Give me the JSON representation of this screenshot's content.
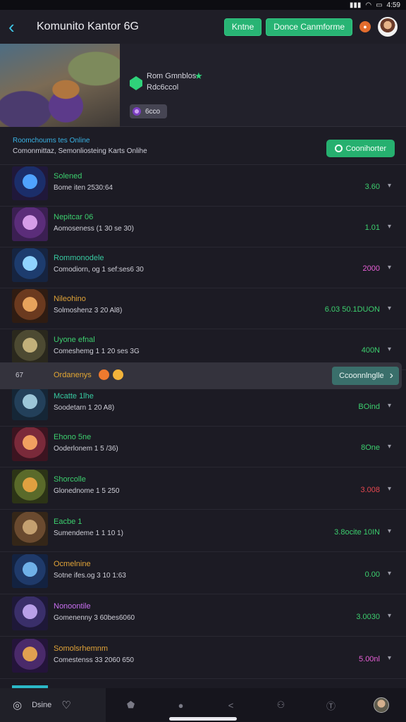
{
  "status": {
    "time": "4:59",
    "wifi": "wifi-icon",
    "signal": "signal-icon",
    "battery": "battery-icon"
  },
  "header": {
    "title": "Komunito Kantor 6G",
    "btn1": "Kntne",
    "btn2": "Donce Canmforme",
    "notif_icon": "notification-icon",
    "avatar": "profile-avatar"
  },
  "hero": {
    "name": "Rom Gmnblos",
    "sub": "Rdc6ccol",
    "chip": "6cco"
  },
  "section": {
    "title": "Roomchoums tes Online",
    "sub": "Comonmittaz, Semonliosteing Karts Onlihe",
    "button": "Coonihorter"
  },
  "banner": {
    "left": "67",
    "text": "Ordanenys",
    "button": "Ccoonnlnglle"
  },
  "players": [
    {
      "name": "Solened",
      "sub": "Bome iten 2530:64",
      "value": "3.60",
      "color": "#3ccf6e",
      "value_color": "#3ccf6e",
      "thumb": [
        "#1b2e6a",
        "#4fa3ff",
        "#20183a"
      ]
    },
    {
      "name": "Nepitcar 06",
      "sub": "Aomoseness (1 30 se 30)",
      "value": "1.01",
      "color": "#3ccf6e",
      "value_color": "#3ccf6e",
      "thumb": [
        "#5b2d7a",
        "#d59ce8",
        "#3b1f52"
      ]
    },
    {
      "name": "Rommonodele",
      "sub": "Comodiorn, og 1 sef:ses6 30",
      "value": "2000",
      "color": "#37c9a0",
      "value_color": "#e65fd6",
      "thumb": [
        "#1d3c6e",
        "#8fd3ff",
        "#162440"
      ]
    },
    {
      "name": "Nileohino",
      "sub": "Solmoshenz 3 20 Al8)",
      "value": "6.03 50.1DUON",
      "color": "#e0a338",
      "value_color": "#3ccf6e",
      "thumb": [
        "#6b3a1f",
        "#e6a35c",
        "#2f1c12"
      ]
    },
    {
      "name": "Uyone efnal",
      "sub": "Comeshemg 1 1 20 ses 3G",
      "value": "400N",
      "color": "#3ccf6e",
      "value_color": "#3ccf6e",
      "thumb": [
        "#4d4a32",
        "#c2b07a",
        "#2a281d"
      ]
    },
    {
      "name": "Mcatte 1lhe",
      "sub": "Soodetarn 1 20 A8)",
      "value": "BOind",
      "color": "#37c9a0",
      "value_color": "#3ccf6e",
      "thumb": [
        "#23405a",
        "#9cc6d8",
        "#152636"
      ]
    },
    {
      "name": "Ehono 5ne",
      "sub": "Ooderlonem 1 5 /36)",
      "value": "8One",
      "color": "#3ccf6e",
      "value_color": "#3ccf6e",
      "thumb": [
        "#7a2a3a",
        "#f0a060",
        "#3c1420"
      ]
    },
    {
      "name": "Shorcolle",
      "sub": "Glonednome 1 5 250",
      "value": "3.008",
      "color": "#3ccf6e",
      "value_color": "#e6474f",
      "thumb": [
        "#5a6a2a",
        "#e0a040",
        "#2c3416"
      ]
    },
    {
      "name": "Eacbe 1",
      "sub": "Sumendeme 1 1 10 1)",
      "value": "3.8ocite 10IN",
      "color": "#3ccf6e",
      "value_color": "#3ccf6e",
      "thumb": [
        "#6a4a2f",
        "#c4a070",
        "#342618"
      ]
    },
    {
      "name": "Ocmelnine",
      "sub": "Sotne ifes.og 3 10 1:63",
      "value": "0.00",
      "color": "#e0a338",
      "value_color": "#3ccf6e",
      "thumb": [
        "#1f3a6a",
        "#6fb0e8",
        "#132240"
      ]
    },
    {
      "name": "Nonoontile",
      "sub": "Gomenenny 3 60bes6060",
      "value": "3.0030",
      "color": "#c86ff0",
      "value_color": "#3ccf6e",
      "thumb": [
        "#3a2f6a",
        "#b8a0e8",
        "#1e1838"
      ]
    },
    {
      "name": "Somolsrhemnm",
      "sub": "Comestenss 33 2060 650",
      "value": "5.00nl",
      "color": "#e0a338",
      "value_color": "#e65fd6",
      "thumb": [
        "#4a2a6a",
        "#e0a050",
        "#24143a"
      ]
    }
  ],
  "bottomnav": {
    "home_label": "Dsine",
    "icons": [
      "home-icon",
      "heart-icon",
      "shield-icon",
      "circle-icon",
      "share-icon",
      "group-icon",
      "text-icon",
      "profile-avatar"
    ]
  }
}
